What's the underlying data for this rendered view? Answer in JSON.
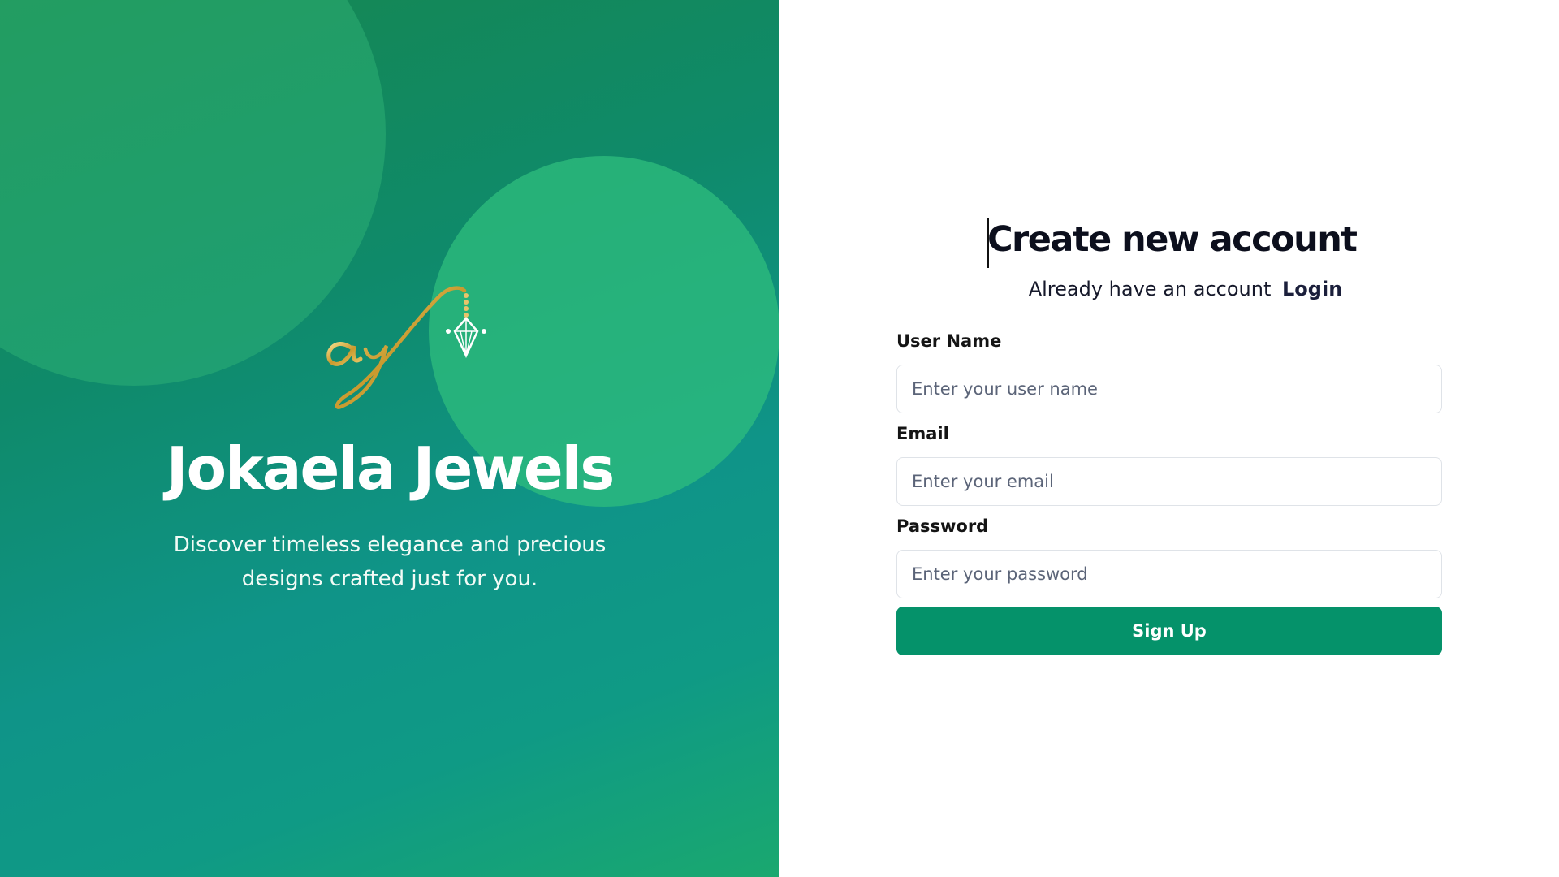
{
  "brand": {
    "name": "Jokaela Jewels",
    "tagline": "Discover timeless elegance and precious designs crafted just for you.",
    "logo_icon": "aj-monogram-logo",
    "gradient_colors": [
      "#16874f",
      "#0f9488",
      "#1aa86f"
    ]
  },
  "form": {
    "heading": "Create new account",
    "login_prompt": "Already have an account",
    "login_link": "Login",
    "fields": [
      {
        "label": "User Name",
        "placeholder": "Enter your user name"
      },
      {
        "label": "Email",
        "placeholder": "Enter your email"
      },
      {
        "label": "Password",
        "placeholder": "Enter your password"
      }
    ],
    "submit_label": "Sign Up",
    "accent_color": "#05926a"
  }
}
